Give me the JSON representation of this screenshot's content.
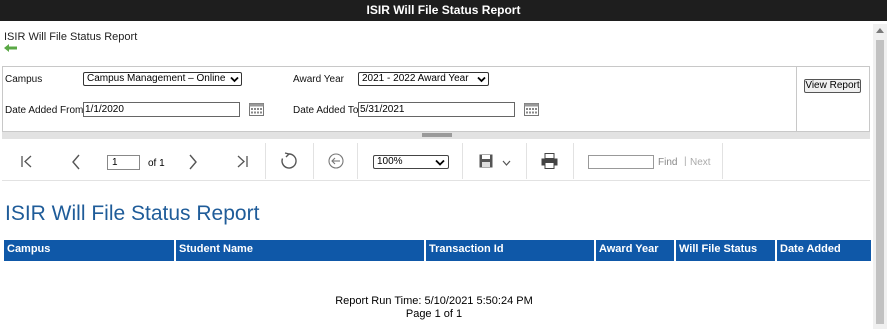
{
  "window": {
    "title": "ISIR Will File Status Report"
  },
  "header": {
    "title": "ISIR Will File Status Report"
  },
  "params": {
    "campus_label": "Campus",
    "campus_value": "Campus Management – Online",
    "award_year_label": "Award Year",
    "award_year_value": "2021 - 2022 Award Year",
    "date_from_label": "Date Added From",
    "date_from_value": "1/1/2020",
    "date_to_label": "Date Added To",
    "date_to_value": "5/31/2021",
    "view_report_label": "View Report"
  },
  "toolbar": {
    "page_value": "1",
    "of_label": "of 1",
    "zoom_value": "100%",
    "find_label": "Find",
    "find_separator": "|",
    "next_label": "Next",
    "icons": [
      "first-page-icon",
      "previous-page-icon",
      "next-page-icon",
      "last-page-icon",
      "refresh-icon",
      "back-to-parent-icon",
      "save-icon",
      "print-icon"
    ]
  },
  "report": {
    "title": "ISIR Will File Status Report",
    "columns": [
      "Campus",
      "Student Name",
      "Transaction Id",
      "Award Year",
      "Will File Status",
      "Date Added"
    ],
    "run_time": "Report Run Time: 5/10/2021 5:50:24 PM",
    "page_info": "Page 1 of 1"
  },
  "colors": {
    "titlebar": "#1e1e1e",
    "report_title": "#1f5c99",
    "table_header": "#0f58a8",
    "back_arrow": "#5aa845"
  }
}
